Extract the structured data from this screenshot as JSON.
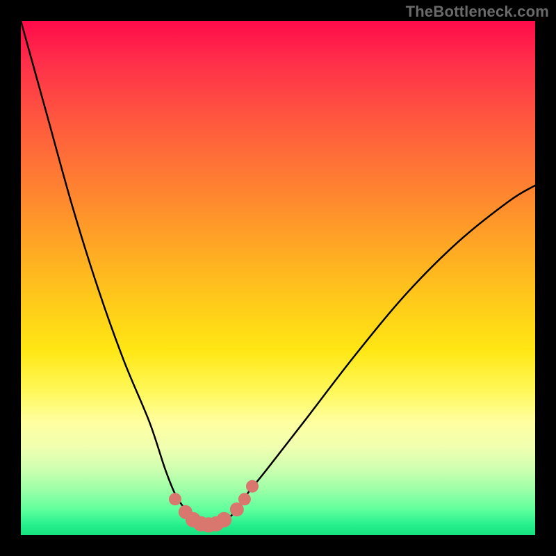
{
  "watermark": "TheBottleneck.com",
  "chart_data": {
    "type": "line",
    "title": "",
    "xlabel": "",
    "ylabel": "",
    "xlim": [
      0,
      100
    ],
    "ylim": [
      0,
      100
    ],
    "series": [
      {
        "name": "bottleneck-curve",
        "x": [
          0,
          5,
          10,
          15,
          20,
          25,
          28,
          30,
          32,
          34,
          36,
          38,
          40,
          42,
          44,
          48,
          55,
          65,
          75,
          85,
          95,
          100
        ],
        "y": [
          100,
          82,
          64,
          48,
          34,
          22,
          13,
          8,
          5,
          3,
          2,
          2,
          3,
          5,
          8,
          13,
          22,
          35,
          47,
          57,
          65,
          68
        ]
      }
    ],
    "markers": {
      "name": "bottleneck-markers",
      "x": [
        30,
        32,
        33.5,
        35,
        36.5,
        38,
        39.5,
        42,
        43.5,
        45
      ],
      "y": [
        7,
        4.5,
        3,
        2.2,
        2,
        2.2,
        3,
        5,
        7,
        9.5
      ],
      "r": [
        9,
        10,
        11,
        11,
        11,
        11,
        11,
        10,
        9,
        9
      ]
    },
    "gradient_stops": [
      {
        "pct": 0,
        "color": "#ff0b4a"
      },
      {
        "pct": 8,
        "color": "#ff2f4a"
      },
      {
        "pct": 20,
        "color": "#ff5a3e"
      },
      {
        "pct": 35,
        "color": "#ff8a2e"
      },
      {
        "pct": 52,
        "color": "#ffc21c"
      },
      {
        "pct": 64,
        "color": "#ffe714"
      },
      {
        "pct": 72,
        "color": "#fff85a"
      },
      {
        "pct": 78,
        "color": "#ffffa0"
      },
      {
        "pct": 83,
        "color": "#f0ffb0"
      },
      {
        "pct": 87,
        "color": "#cfffb0"
      },
      {
        "pct": 91,
        "color": "#9effa8"
      },
      {
        "pct": 95,
        "color": "#61ff9d"
      },
      {
        "pct": 98,
        "color": "#25f08d"
      },
      {
        "pct": 100,
        "color": "#17df7e"
      }
    ],
    "marker_color": "#d9766e",
    "curve_color": "#000000"
  }
}
